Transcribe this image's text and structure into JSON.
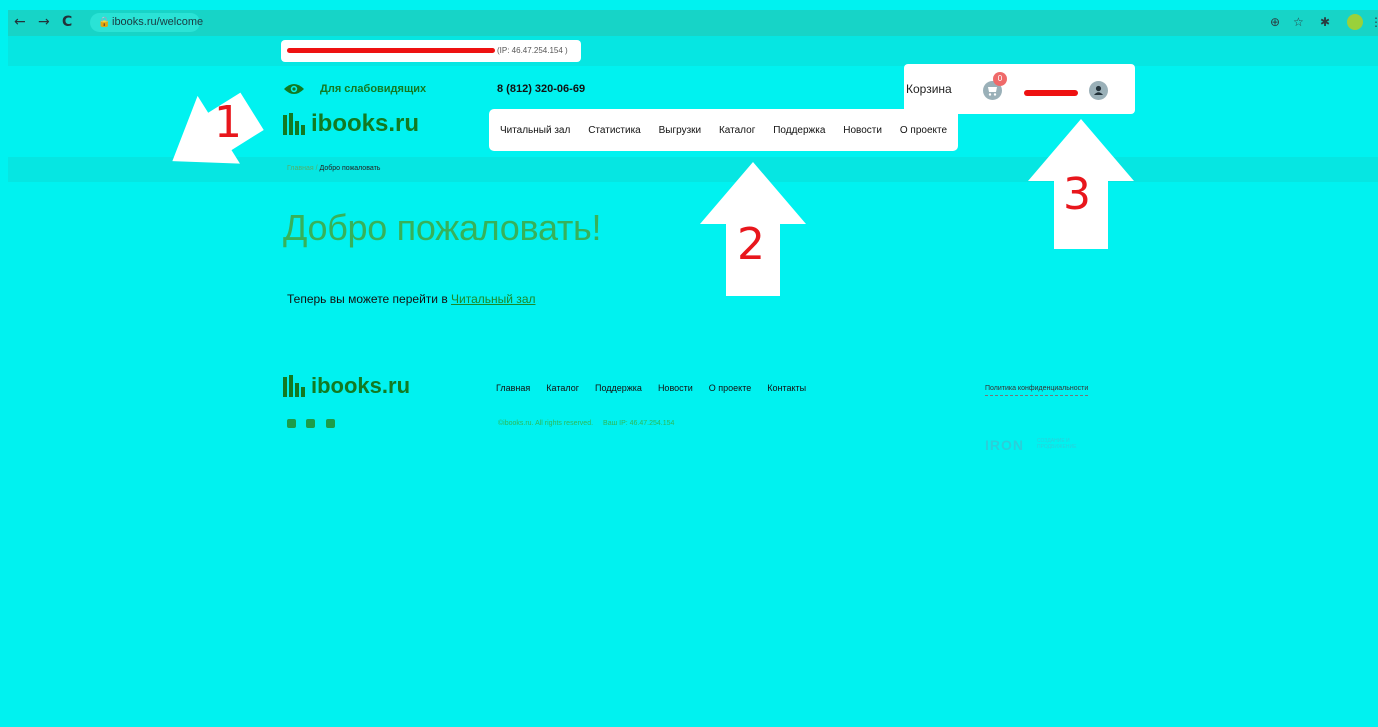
{
  "browser": {
    "url": "ibooks.ru/welcome",
    "back_icon": "←",
    "forward_icon": "→",
    "reload_icon": "C",
    "lock_icon": "🔒",
    "zoom_icon": "⊕",
    "star_icon": "☆",
    "puzzle_icon": "✱",
    "menu_icon": "⋮"
  },
  "header": {
    "ip_text": "(IP: 46.47.254.154 )",
    "accessibility_label": "Для слабовидящих",
    "phone": "8 (812) 320-06-69",
    "logo_text": "ibooks.ru",
    "menu": [
      "Читальный зал",
      "Статистика",
      "Выгрузки",
      "Каталог",
      "Поддержка",
      "Новости",
      "О проекте"
    ],
    "cart_label": "Корзина",
    "cart_count": "0"
  },
  "breadcrumb": {
    "home": "Главная",
    "separator": "/",
    "current": "Добро пожаловать"
  },
  "main": {
    "title": "Добро пожаловать!",
    "body_prefix": "Теперь вы можете перейти в ",
    "body_link": "Читальный зал"
  },
  "footer": {
    "logo_text": "ibooks.ru",
    "menu": [
      "Главная",
      "Каталог",
      "Поддержка",
      "Новости",
      "О проекте",
      "Контакты"
    ],
    "policy": "Политика конфиденциальности",
    "copyright": "©ibooks.ru. All rights reserved.",
    "ip": "Ваш IP: 46.47.254.154",
    "dev_logo": "IRON",
    "dev_sub": "СОЗДАНИЕ И ПРОДВИЖЕНИЕ"
  },
  "annotations": [
    "1",
    "2",
    "3"
  ],
  "colors": {
    "page_bg": "#00f2f0",
    "brand_green": "#127a22",
    "redaction": "#ee1111",
    "annotation": "#e8161c"
  }
}
